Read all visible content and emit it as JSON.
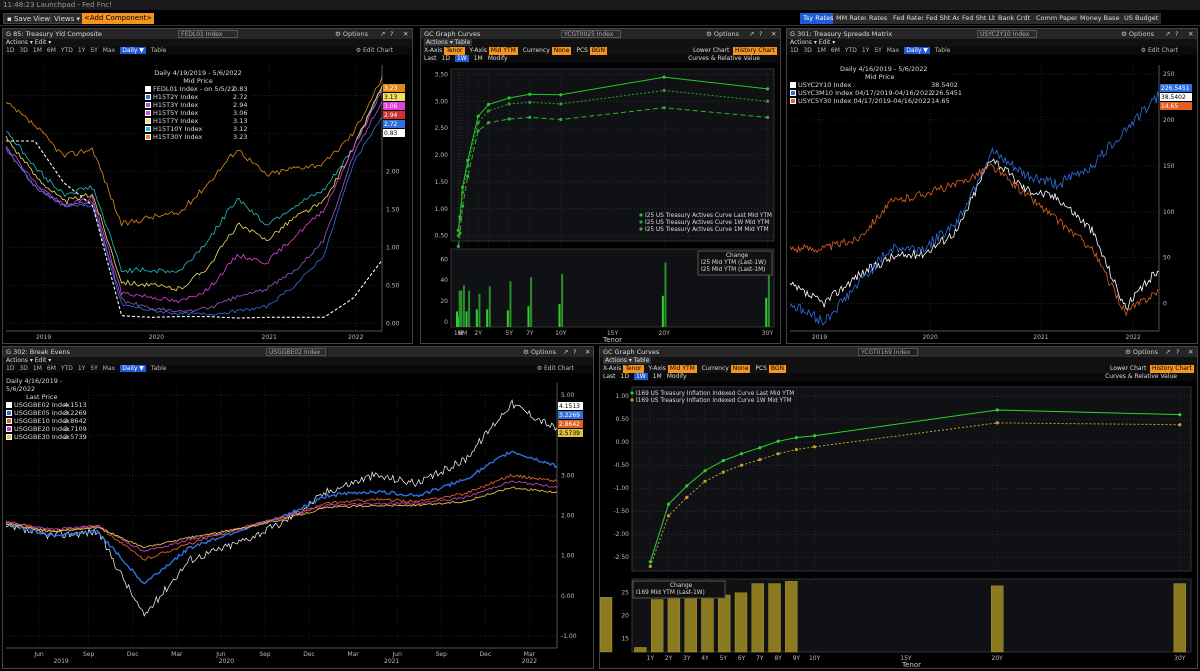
{
  "window": {
    "title": "11:48:23 Launchpad - Fed Fnc!"
  },
  "toolbar": {
    "save_view": "Save View",
    "views": "Views ▾",
    "component_placeholder": "<Add Component>"
  },
  "rates_tabs": [
    "Tsy Rates",
    "MM Rates",
    "Rates",
    "Fed Rates",
    "Fed Sht As",
    "Fed Sht Lb",
    "Bank Crdt",
    "Comm Paper",
    "Money Base",
    "US Budget"
  ],
  "panel1": {
    "title": "G 85: Treasury Yld Composite",
    "ticker": "FEDL01 Index",
    "options": "Options",
    "actions": "Actions ▾  Edit ▾",
    "periods": [
      "1D",
      "3D",
      "1M",
      "6M",
      "YTD",
      "1Y",
      "5Y",
      "Max",
      "Daily ▼",
      "Table"
    ],
    "edit_chart": "Edit Chart",
    "legend_title": "Daily 4/19/2019 - 5/6/2022",
    "legend_sub": "Mid Price",
    "legend": [
      {
        "name": "FEDL01 Index - on 5/5/22",
        "value": "0.83",
        "color": "#ffffff"
      },
      {
        "name": "H15T2Y Index",
        "value": "2.72",
        "color": "#2f6fe0"
      },
      {
        "name": "H15T3Y Index",
        "value": "2.94",
        "color": "#9b59d0"
      },
      {
        "name": "H15T5Y Index",
        "value": "3.06",
        "color": "#e040e0"
      },
      {
        "name": "H15T7Y Index",
        "value": "3.13",
        "color": "#f0e060"
      },
      {
        "name": "H15T10Y Index",
        "value": "3.12",
        "color": "#20c0c0"
      },
      {
        "name": "H15T30Y Index",
        "value": "3.23",
        "color": "#e08a1a"
      }
    ],
    "yticks": [
      "3.00",
      "2.50",
      "2.00",
      "1.50",
      "1.00",
      "0.50",
      "0.00"
    ],
    "xticks": [
      "2019",
      "2020",
      "2021",
      "2022"
    ],
    "right_labels": [
      {
        "text": "3.23",
        "color": "#e08a1a"
      },
      {
        "text": "3.13",
        "color": "#f0e060"
      },
      {
        "text": "3.06",
        "color": "#e040e0"
      },
      {
        "text": "2.94",
        "color": "#d03030"
      },
      {
        "text": "2.72",
        "color": "#2f6fe0"
      },
      {
        "text": "0.83",
        "color": "#ffffff"
      }
    ]
  },
  "panel2": {
    "title": "GC Graph Curves",
    "ticker": "YCGT0025 Index",
    "options": "Options",
    "actions": "Actions ▾  Table",
    "xaxis_label": "X-Axis",
    "xaxis_val": "Tenor",
    "yaxis_label": "Y-Axis",
    "yaxis_val": "Mid YTM",
    "currency_label": "Currency",
    "currency_val": "None",
    "pcs_label": "PCS",
    "pcs_val": "BGN",
    "lower_chart": "Lower Chart",
    "lower_val": "History Chart",
    "row3": [
      "Last",
      "1D",
      "1W",
      "1M",
      "Modify"
    ],
    "row3_right": "Curves & Relative Value",
    "legend": [
      "I25 US Treasury Actives Curve Last Mid YTM",
      "I25 US Treasury Actives Curve 1W Mid YTM",
      "I25 US Treasury Actives Curve 1M Mid YTM"
    ],
    "yticks": [
      "3.50",
      "3.00",
      "2.50",
      "2.00",
      "1.50",
      "1.00",
      "0.50"
    ],
    "lower_yticks": [
      "60",
      "40",
      "20",
      "0"
    ],
    "change_legend": [
      "Change",
      "I25 Mid YTM (Last-1W)",
      "I25 Mid YTM (Last-1M)"
    ],
    "xticks": [
      "1M",
      "6M",
      "2Y",
      "5Y",
      "7Y",
      "10Y",
      "15Y",
      "20Y",
      "30Y"
    ],
    "xlabel": "Tenor"
  },
  "panel3": {
    "title": "G 301: Treasury Spreads Matrix",
    "ticker": "USYC2Y10 Index",
    "options": "Options",
    "actions": "Actions ▾  Edit ▾",
    "periods": [
      "1D",
      "3D",
      "1M",
      "6M",
      "YTD",
      "1Y",
      "5Y",
      "Max",
      "Daily ▼",
      "Table"
    ],
    "edit_chart": "Edit Chart",
    "legend_title": "Daily 4/16/2019 - 5/6/2022",
    "legend_sub": "Mid Price",
    "legend": [
      {
        "name": "USYC2Y10 Index",
        "value": "38.5402",
        "color": "#ffffff"
      },
      {
        "name": "USYC3M10 Index 04/17/2019-04/16/2022",
        "value": "226.5451",
        "color": "#2f6fe0"
      },
      {
        "name": "USYC5Y30 Index 04/17/2019-04/16/2022",
        "value": "14.65",
        "color": "#e06020"
      }
    ],
    "yticks": [
      "250",
      "200",
      "150",
      "100",
      "50",
      "0"
    ],
    "xticks": [
      "2019",
      "2020",
      "2021",
      "2022"
    ],
    "right_labels": [
      {
        "text": "226.5451",
        "color": "#2f6fe0"
      },
      {
        "text": "38.5402",
        "color": "#ffffff"
      },
      {
        "text": "14.65",
        "color": "#e06020"
      }
    ]
  },
  "panel4": {
    "title": "G 302: Break Evens",
    "ticker": "USGGBE02 Index",
    "options": "Options",
    "actions": "Actions ▾  Edit ▾",
    "periods": [
      "1D",
      "3D",
      "1M",
      "6M",
      "YTD",
      "1Y",
      "5Y",
      "Max",
      "Daily ▼",
      "Table"
    ],
    "edit_chart": "Edit Chart",
    "legend_title": "Daily 4/16/2019 - 5/6/2022",
    "legend_sub": "Last Price",
    "legend": [
      {
        "name": "USGGBE02 Index",
        "value": "4.1513",
        "color": "#ffffff"
      },
      {
        "name": "USGGBE05 Index",
        "value": "3.2269",
        "color": "#2f6fe0"
      },
      {
        "name": "USGGBE10 Index",
        "value": "2.8642",
        "color": "#e06020"
      },
      {
        "name": "USGGBE20 Index",
        "value": "2.7109",
        "color": "#c040c0"
      },
      {
        "name": "USGGBE30 Index",
        "value": "2.5739",
        "color": "#e0c040"
      }
    ],
    "yticks": [
      "5.00",
      "4.00",
      "3.00",
      "2.00",
      "1.00",
      "0.00",
      "-1.00"
    ],
    "xticks": [
      "Jun",
      "Sep",
      "Dec",
      "Mar",
      "Jun",
      "Sep",
      "Dec",
      "Mar",
      "Jun",
      "Sep",
      "Dec",
      "Mar"
    ],
    "years": [
      "2019",
      "2020",
      "2021",
      "2022"
    ],
    "right_labels": [
      {
        "text": "4.1513",
        "color": "#ffffff"
      },
      {
        "text": "3.2269",
        "color": "#2f6fe0"
      },
      {
        "text": "2.8642",
        "color": "#e06020"
      },
      {
        "text": "2.5739",
        "color": "#e0c040"
      }
    ]
  },
  "panel5": {
    "title": "GC Graph Curves",
    "ticker": "YCGT0169 Index",
    "options": "Options",
    "actions": "Actions ▾  Table",
    "xaxis_label": "X-Axis",
    "xaxis_val": "Tenor",
    "yaxis_label": "Y-Axis",
    "yaxis_val": "Mid YTM",
    "currency_label": "Currency",
    "currency_val": "None",
    "pcs_label": "PCS",
    "pcs_val": "BGN",
    "lower_chart": "Lower Chart",
    "lower_val": "History Chart",
    "row3": [
      "Last",
      "1D",
      "1W",
      "1M",
      "Modify"
    ],
    "row3_right": "Curves & Relative Value",
    "legend": [
      "I169 US Treasury Inflation Indexed Curve Last Mid YTM",
      "I169 US Treasury Inflation Indexed Curve 1W Mid YTM"
    ],
    "yticks": [
      "1.00",
      "0.50",
      "0.00",
      "-0.50",
      "-1.00",
      "-1.50",
      "-2.00",
      "-2.50"
    ],
    "lower_yticks": [
      "25",
      "20",
      "15"
    ],
    "change_legend": [
      "Change",
      "I169 Mid YTM (Last-1W)"
    ],
    "xticks": [
      "1Y",
      "2Y",
      "3Y",
      "4Y",
      "5Y",
      "6Y",
      "7Y",
      "8Y",
      "9Y",
      "10Y",
      "15Y",
      "20Y",
      "30Y"
    ],
    "xlabel": "Tenor"
  },
  "chart_data": [
    {
      "type": "line",
      "title": "G 85: Treasury Yld Composite",
      "x": [
        "2019-04",
        "2019-07",
        "2019-10",
        "2020-01",
        "2020-03",
        "2020-06",
        "2020-09",
        "2021-01",
        "2021-04",
        "2021-07",
        "2021-10",
        "2022-01",
        "2022-03",
        "2022-05"
      ],
      "series": [
        {
          "name": "H15T30Y Index",
          "values": [
            2.9,
            2.6,
            2.2,
            2.3,
            1.3,
            1.4,
            1.45,
            1.85,
            2.3,
            1.95,
            2.05,
            2.1,
            2.5,
            3.23
          ]
        },
        {
          "name": "H15T10Y Index",
          "values": [
            2.55,
            2.05,
            1.7,
            1.8,
            0.7,
            0.7,
            0.68,
            1.1,
            1.65,
            1.3,
            1.55,
            1.75,
            2.3,
            3.12
          ]
        },
        {
          "name": "H15T7Y Index",
          "values": [
            2.45,
            1.95,
            1.6,
            1.7,
            0.55,
            0.5,
            0.45,
            0.75,
            1.3,
            1.1,
            1.4,
            1.6,
            2.3,
            3.13
          ]
        },
        {
          "name": "H15T5Y Index",
          "values": [
            2.35,
            1.85,
            1.55,
            1.65,
            0.4,
            0.35,
            0.28,
            0.45,
            0.9,
            0.8,
            1.15,
            1.5,
            2.3,
            3.06
          ]
        },
        {
          "name": "H15T3Y Index",
          "values": [
            2.3,
            1.8,
            1.55,
            1.6,
            0.3,
            0.2,
            0.15,
            0.2,
            0.35,
            0.45,
            0.7,
            1.1,
            2.2,
            2.94
          ]
        },
        {
          "name": "H15T2Y Index",
          "values": [
            2.3,
            1.8,
            1.55,
            1.55,
            0.25,
            0.17,
            0.13,
            0.12,
            0.16,
            0.22,
            0.5,
            0.9,
            2.1,
            2.72
          ]
        },
        {
          "name": "FEDL01 Index - on 5/5/22",
          "values": [
            2.4,
            2.4,
            1.85,
            1.55,
            0.1,
            0.08,
            0.09,
            0.09,
            0.07,
            0.08,
            0.08,
            0.08,
            0.33,
            0.83
          ]
        }
      ],
      "ylim": [
        -0.1,
        3.4
      ]
    },
    {
      "type": "line",
      "title": "GC Graph Curves",
      "categories": [
        "1M",
        "3M",
        "6M",
        "1Y",
        "2Y",
        "3Y",
        "5Y",
        "7Y",
        "10Y",
        "20Y",
        "30Y"
      ],
      "series": [
        {
          "name": "I25 US Treasury Actives Curve Last Mid YTM",
          "values": [
            0.6,
            0.85,
            1.4,
            1.9,
            2.72,
            2.94,
            3.06,
            3.13,
            3.12,
            3.45,
            3.23
          ]
        },
        {
          "name": "I25 US Treasury Actives Curve 1W Mid YTM",
          "values": [
            0.5,
            0.8,
            1.3,
            1.8,
            2.6,
            2.82,
            2.95,
            2.98,
            2.95,
            3.2,
            3.0
          ]
        },
        {
          "name": "I25 US Treasury Actives Curve 1M Mid YTM",
          "values": [
            0.3,
            0.55,
            1.05,
            1.6,
            2.45,
            2.6,
            2.67,
            2.7,
            2.66,
            2.88,
            2.7
          ]
        }
      ],
      "lower": {
        "type": "bar",
        "series": [
          {
            "name": "I25 Mid YTM (Last-1W)",
            "values": [
              10,
              5,
              10,
              10,
              12,
              12,
              11,
              15,
              17,
              25,
              23
            ]
          },
          {
            "name": "I25 Mid YTM (Last-1M)",
            "values": [
              30,
              30,
              35,
              30,
              27,
              34,
              39,
              43,
              46,
              57,
              53
            ]
          }
        ]
      },
      "ylim": [
        0.4,
        3.6
      ]
    },
    {
      "type": "line",
      "title": "G 301: Treasury Spreads Matrix",
      "x": [
        "2019-04",
        "2019-08",
        "2019-12",
        "2020-04",
        "2020-08",
        "2020-12",
        "2021-03",
        "2021-06",
        "2021-09",
        "2021-12",
        "2022-03",
        "2022-05"
      ],
      "series": [
        {
          "name": "USYC2Y10 Index",
          "values": [
            20,
            0,
            30,
            50,
            55,
            80,
            160,
            125,
            115,
            80,
            -5,
            38.54
          ]
        },
        {
          "name": "USYC3M10 Index 04/17/2019-04/16/2022",
          "values": [
            0,
            -20,
            20,
            60,
            60,
            90,
            165,
            140,
            130,
            150,
            190,
            226.55
          ]
        },
        {
          "name": "USYC5Y30 Index 04/17/2019-04/16/2022",
          "values": [
            60,
            60,
            70,
            110,
            120,
            130,
            150,
            120,
            90,
            60,
            -10,
            14.65
          ]
        }
      ],
      "ylim": [
        -30,
        260
      ]
    },
    {
      "type": "line",
      "title": "G 302: Break Evens",
      "x": [
        "2019-04",
        "2019-09",
        "2019-12",
        "2020-03",
        "2020-06",
        "2020-09",
        "2020-12",
        "2021-03",
        "2021-06",
        "2021-09",
        "2021-12",
        "2022-03",
        "2022-05"
      ],
      "series": [
        {
          "name": "USGGBE02 Index",
          "values": [
            1.7,
            1.5,
            1.6,
            -0.5,
            0.9,
            1.3,
            1.8,
            2.6,
            3.0,
            2.8,
            3.4,
            4.8,
            4.15
          ]
        },
        {
          "name": "USGGBE05 Index",
          "values": [
            1.8,
            1.5,
            1.6,
            0.3,
            1.2,
            1.6,
            1.95,
            2.5,
            2.6,
            2.5,
            2.9,
            3.6,
            3.23
          ]
        },
        {
          "name": "USGGBE10 Index",
          "values": [
            1.85,
            1.6,
            1.75,
            0.9,
            1.3,
            1.65,
            1.95,
            2.3,
            2.4,
            2.35,
            2.55,
            3.0,
            2.86
          ]
        },
        {
          "name": "USGGBE20 Index",
          "values": [
            1.85,
            1.65,
            1.75,
            1.1,
            1.4,
            1.65,
            1.95,
            2.25,
            2.3,
            2.3,
            2.45,
            2.85,
            2.71
          ]
        },
        {
          "name": "USGGBE30 Index",
          "values": [
            1.8,
            1.6,
            1.7,
            1.2,
            1.45,
            1.65,
            1.9,
            2.2,
            2.25,
            2.25,
            2.35,
            2.7,
            2.57
          ]
        }
      ],
      "ylim": [
        -1.3,
        5.3
      ]
    },
    {
      "type": "line",
      "title": "GC Graph Curves",
      "categories": [
        "1Y",
        "2Y",
        "3Y",
        "4Y",
        "5Y",
        "6Y",
        "7Y",
        "8Y",
        "9Y",
        "10Y",
        "20Y",
        "30Y"
      ],
      "series": [
        {
          "name": "I169 US Treasury Inflation Indexed Curve Last Mid YTM",
          "values": [
            -2.6,
            -1.35,
            -0.95,
            -0.62,
            -0.4,
            -0.25,
            -0.12,
            0.02,
            0.1,
            0.14,
            0.7,
            0.6
          ]
        },
        {
          "name": "I169 US Treasury Inflation Indexed Curve 1W Mid YTM",
          "values": [
            -2.7,
            -1.6,
            -1.2,
            -0.85,
            -0.65,
            -0.5,
            -0.38,
            -0.25,
            -0.16,
            -0.1,
            0.42,
            0.38
          ]
        }
      ],
      "lower": {
        "type": "bar",
        "series": [
          {
            "name": "I169 Mid YTM (Last-1W)",
            "values": [
              13,
              23.5,
              24,
              24,
              24,
              24.5,
              25,
              27,
              27,
              27.5,
              26.5,
              27,
              24
            ]
          }
        ]
      },
      "ylim": [
        -2.8,
        1.2
      ]
    }
  ]
}
